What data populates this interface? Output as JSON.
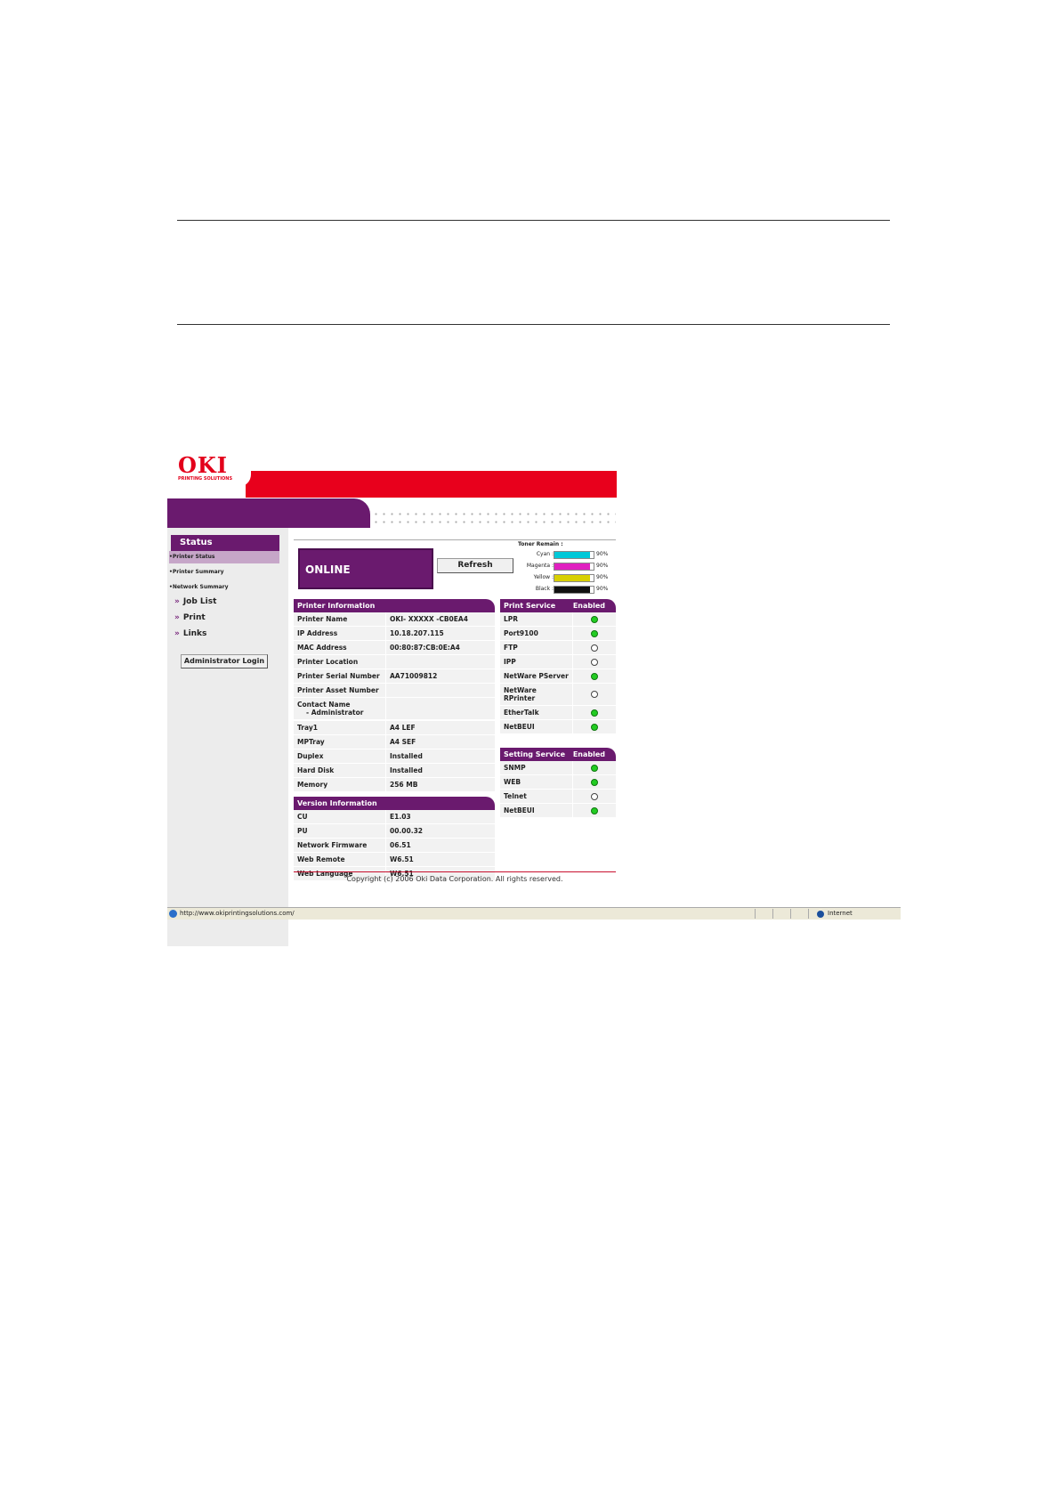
{
  "header": {
    "logo": "OKI",
    "logo_sub": "PRINTING SOLUTIONS"
  },
  "sidebar": {
    "section": "Status",
    "sub_items": [
      "Printer Status",
      "Printer Summary",
      "Network Summary"
    ],
    "links": [
      "Job List",
      "Print",
      "Links"
    ],
    "admin_button": "Administrator Login"
  },
  "status": {
    "state": "ONLINE",
    "refresh_label": "Refresh"
  },
  "toner": {
    "title": "Toner Remain :",
    "items": [
      {
        "label": "Cyan :",
        "pct": "90%",
        "value": 0.9,
        "color": "#00c8d8"
      },
      {
        "label": "Magenta :",
        "pct": "90%",
        "value": 0.9,
        "color": "#e020c0"
      },
      {
        "label": "Yellow :",
        "pct": "90%",
        "value": 0.9,
        "color": "#d8d000"
      },
      {
        "label": "Black :",
        "pct": "90%",
        "value": 0.9,
        "color": "#111111"
      }
    ]
  },
  "printer_info": {
    "title": "Printer Information",
    "rows": [
      {
        "k": "Printer Name",
        "v": "OKI- XXXXX -CB0EA4"
      },
      {
        "k": "IP Address",
        "v": "10.18.207.115"
      },
      {
        "k": "MAC Address",
        "v": "00:80:87:CB:0E:A4"
      },
      {
        "k": "Printer Location",
        "v": ""
      },
      {
        "k": "Printer Serial Number",
        "v": "AA71009812"
      },
      {
        "k": "Printer Asset Number",
        "v": ""
      },
      {
        "k": "Contact Name",
        "k2": "- Administrator",
        "v": ""
      }
    ]
  },
  "hardware": {
    "rows": [
      {
        "k": "Tray1",
        "v": "A4 LEF"
      },
      {
        "k": "MPTray",
        "v": "A4 SEF"
      },
      {
        "k": "Duplex",
        "v": "Installed"
      },
      {
        "k": "Hard Disk",
        "v": "Installed"
      },
      {
        "k": "Memory",
        "v": "256 MB"
      }
    ]
  },
  "version_info": {
    "title": "Version Information",
    "rows": [
      {
        "k": "CU",
        "v": "E1.03"
      },
      {
        "k": "PU",
        "v": "00.00.32"
      },
      {
        "k": "Network Firmware",
        "v": "06.51"
      },
      {
        "k": "Web Remote",
        "v": "W6.51"
      },
      {
        "k": "Web Language",
        "v": "W6.51"
      }
    ]
  },
  "print_service": {
    "title": "Print Service",
    "col2": "Enabled",
    "rows": [
      {
        "k": "LPR",
        "on": true
      },
      {
        "k": "Port9100",
        "on": true
      },
      {
        "k": "FTP",
        "on": false
      },
      {
        "k": "IPP",
        "on": false
      },
      {
        "k": "NetWare PServer",
        "on": true
      },
      {
        "k": "NetWare RPrinter",
        "on": false
      },
      {
        "k": "EtherTalk",
        "on": true
      },
      {
        "k": "NetBEUI",
        "on": true
      }
    ]
  },
  "setting_service": {
    "title": "Setting Service",
    "col2": "Enabled",
    "rows": [
      {
        "k": "SNMP",
        "on": true
      },
      {
        "k": "WEB",
        "on": true
      },
      {
        "k": "Telnet",
        "on": false
      },
      {
        "k": "NetBEUI",
        "on": true
      }
    ]
  },
  "footer": {
    "copyright": "Copyright (c) 2006 Oki Data Corporation. All rights reserved."
  },
  "statusbar": {
    "url": "http://www.okiprintingsolutions.com/",
    "zone": "Internet"
  }
}
